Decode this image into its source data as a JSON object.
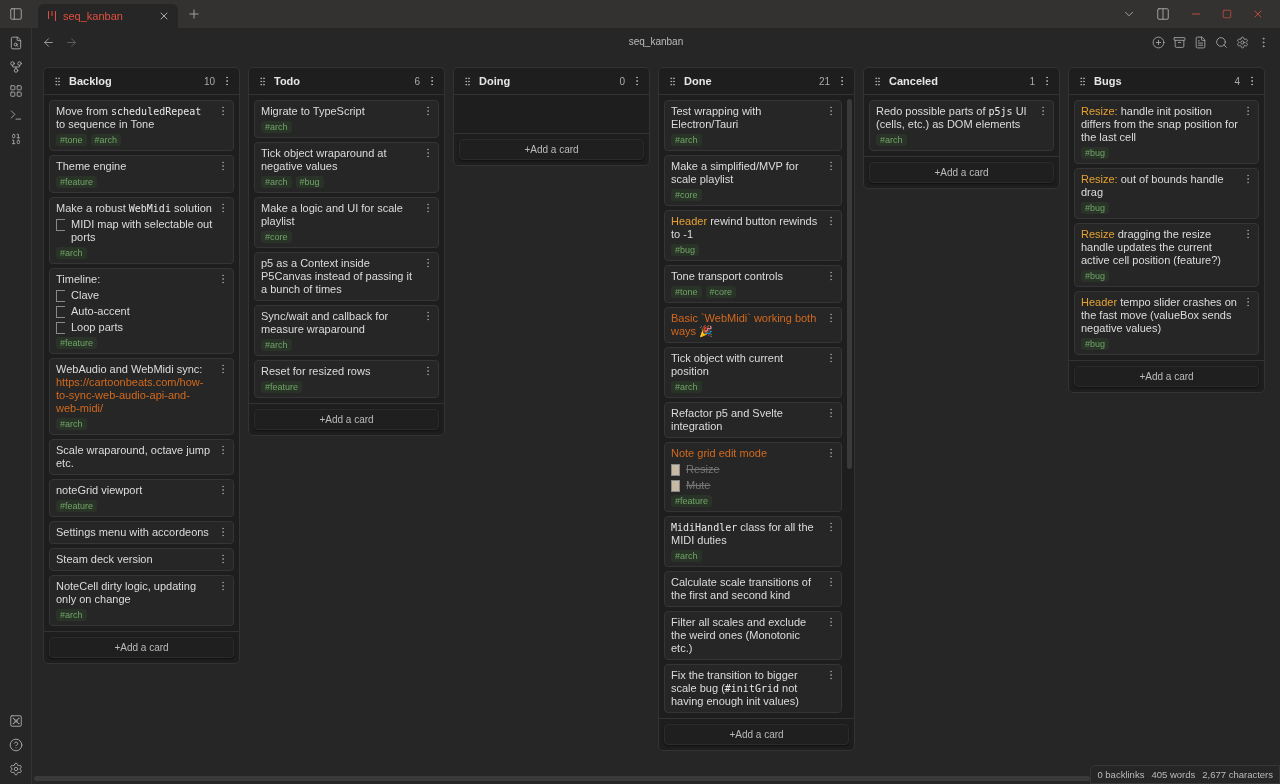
{
  "tabs": [
    {
      "title": "seq_kanban",
      "selected": true
    }
  ],
  "view_title": "seq_kanban",
  "lanes": [
    {
      "title": "Backlog",
      "count": "10",
      "add_button": "+Add a card",
      "cards": [
        {
          "title": [
            {
              "kind": "plain",
              "text": "Move from "
            },
            {
              "kind": "code",
              "text": "scheduledRepeat"
            },
            {
              "kind": "plain",
              "text": " to sequence in Tone"
            }
          ],
          "tags": [
            "#tone",
            "#arch"
          ]
        },
        {
          "title": [
            {
              "kind": "plain",
              "text": "Theme engine"
            }
          ],
          "tags": [
            "#feature"
          ]
        },
        {
          "title": [
            {
              "kind": "plain",
              "text": "Make a robust "
            },
            {
              "kind": "code",
              "text": "WebMidi"
            },
            {
              "kind": "plain",
              "text": " solution"
            }
          ],
          "checklist": [
            {
              "text": "MIDI map with selectable out ports",
              "checked": false
            }
          ],
          "tags": [
            "#arch"
          ]
        },
        {
          "title": [
            {
              "kind": "plain",
              "text": "Timeline:"
            }
          ],
          "checklist": [
            {
              "text": "Clave",
              "checked": false
            },
            {
              "text": "Auto-accent",
              "checked": false
            },
            {
              "text": "Loop parts",
              "checked": false
            }
          ],
          "tags": [
            "#feature"
          ]
        },
        {
          "title": [
            {
              "kind": "plain",
              "text": "WebAudio and WebMidi sync: "
            },
            {
              "kind": "link",
              "text": "https://cartoonbeats.com/how-to-sync-web-audio-api-and-web-midi/"
            }
          ],
          "tags": [
            "#arch"
          ]
        },
        {
          "title": [
            {
              "kind": "plain",
              "text": "Scale wraparound, octave jump etc."
            }
          ]
        },
        {
          "title": [
            {
              "kind": "plain",
              "text": "noteGrid viewport"
            }
          ],
          "tags": [
            "#feature"
          ]
        },
        {
          "title": [
            {
              "kind": "plain",
              "text": "Settings menu with accordeons"
            }
          ]
        },
        {
          "title": [
            {
              "kind": "plain",
              "text": "Steam deck version"
            }
          ]
        },
        {
          "title": [
            {
              "kind": "plain",
              "text": "NoteCell dirty logic, updating only on change"
            }
          ],
          "tags": [
            "#arch"
          ]
        }
      ]
    },
    {
      "title": "Todo",
      "count": "6",
      "add_button": "+Add a card",
      "cards": [
        {
          "title": [
            {
              "kind": "plain",
              "text": "Migrate to TypeScript"
            }
          ],
          "tags": [
            "#arch"
          ]
        },
        {
          "title": [
            {
              "kind": "plain",
              "text": "Tick object wraparound at negative values"
            }
          ],
          "tags": [
            "#arch",
            "#bug"
          ]
        },
        {
          "title": [
            {
              "kind": "plain",
              "text": "Make a logic and UI for scale playlist"
            }
          ],
          "tags": [
            "#core"
          ]
        },
        {
          "title": [
            {
              "kind": "plain",
              "text": "p5 as a Context inside P5Canvas instead of passing it a bunch of times"
            }
          ]
        },
        {
          "title": [
            {
              "kind": "plain",
              "text": "Sync/wait and callback for measure wraparound"
            }
          ],
          "tags": [
            "#arch"
          ]
        },
        {
          "title": [
            {
              "kind": "plain",
              "text": "Reset for resized rows"
            }
          ],
          "tags": [
            "#feature"
          ]
        }
      ]
    },
    {
      "title": "Doing",
      "count": "0",
      "add_button": "+Add a card"
    },
    {
      "title": "Done",
      "count": "21",
      "add_button": "+Add a card",
      "cards": [
        {
          "title": [
            {
              "kind": "plain",
              "text": "Test wrapping with Electron/Tauri"
            }
          ],
          "tags": [
            "#arch"
          ]
        },
        {
          "title": [
            {
              "kind": "plain",
              "text": "Make a simplified/MVP for scale playlist"
            }
          ],
          "tags": [
            "#core"
          ]
        },
        {
          "title": [
            {
              "kind": "highlight",
              "text": "Header"
            },
            {
              "kind": "plain",
              "text": " rewind button rewinds to -1"
            }
          ],
          "tags": [
            "#bug"
          ]
        },
        {
          "title": [
            {
              "kind": "plain",
              "text": "Tone transport controls"
            }
          ],
          "tags": [
            "#tone",
            "#core"
          ]
        },
        {
          "title": [
            {
              "kind": "orange",
              "text": "Basic `WebMidi` working both ways 🎉"
            }
          ]
        },
        {
          "title": [
            {
              "kind": "plain",
              "text": "Tick object with current position"
            }
          ],
          "tags": [
            "#arch"
          ]
        },
        {
          "title": [
            {
              "kind": "plain",
              "text": "Refactor p5 and Svelte integration"
            }
          ]
        },
        {
          "title": [
            {
              "kind": "orange",
              "text": "Note grid edit mode"
            }
          ],
          "checklist": [
            {
              "text": "Resize",
              "checked": true
            },
            {
              "text": "Mute",
              "checked": true
            }
          ],
          "tags": [
            "#feature"
          ]
        },
        {
          "title": [
            {
              "kind": "code",
              "text": "MidiHandler"
            },
            {
              "kind": "plain",
              "text": " class for all the MIDI duties"
            }
          ],
          "tags": [
            "#arch"
          ]
        },
        {
          "title": [
            {
              "kind": "plain",
              "text": "Calculate scale transitions of the first and second kind"
            }
          ]
        },
        {
          "title": [
            {
              "kind": "plain",
              "text": "Filter all scales and exclude the weird ones (Monotonic etc.)"
            }
          ]
        },
        {
          "title": [
            {
              "kind": "plain",
              "text": "Fix the transition to bigger scale bug ("
            },
            {
              "kind": "code",
              "text": "#initGrid"
            },
            {
              "kind": "plain",
              "text": " not having enough init values)"
            }
          ]
        }
      ]
    },
    {
      "title": "Canceled",
      "count": "1",
      "add_button": "+Add a card",
      "cards": [
        {
          "title": [
            {
              "kind": "plain",
              "text": "Redo possible parts of "
            },
            {
              "kind": "code",
              "text": "p5js"
            },
            {
              "kind": "plain",
              "text": " UI (cells, etc.) as DOM elements"
            }
          ],
          "tags": [
            "#arch"
          ]
        }
      ]
    },
    {
      "title": "Bugs",
      "count": "4",
      "add_button": "+Add a card",
      "cards": [
        {
          "title": [
            {
              "kind": "highlight",
              "text": "Resize:"
            },
            {
              "kind": "plain",
              "text": " handle init position differs from the snap position for the last cell"
            }
          ],
          "tags": [
            "#bug"
          ]
        },
        {
          "title": [
            {
              "kind": "highlight",
              "text": "Resize:"
            },
            {
              "kind": "plain",
              "text": " out of bounds handle drag"
            }
          ],
          "tags": [
            "#bug"
          ]
        },
        {
          "title": [
            {
              "kind": "highlight",
              "text": "Resize"
            },
            {
              "kind": "plain",
              "text": " dragging the resize handle updates the current active cell position (feature?)"
            }
          ],
          "tags": [
            "#bug"
          ]
        },
        {
          "title": [
            {
              "kind": "highlight",
              "text": "Header"
            },
            {
              "kind": "plain",
              "text": " tempo slider crashes on the fast move (valueBox sends negative values)"
            }
          ],
          "tags": [
            "#bug"
          ]
        }
      ]
    }
  ],
  "status_bar": [
    "0 backlinks",
    "405 words",
    "2,677 characters"
  ]
}
